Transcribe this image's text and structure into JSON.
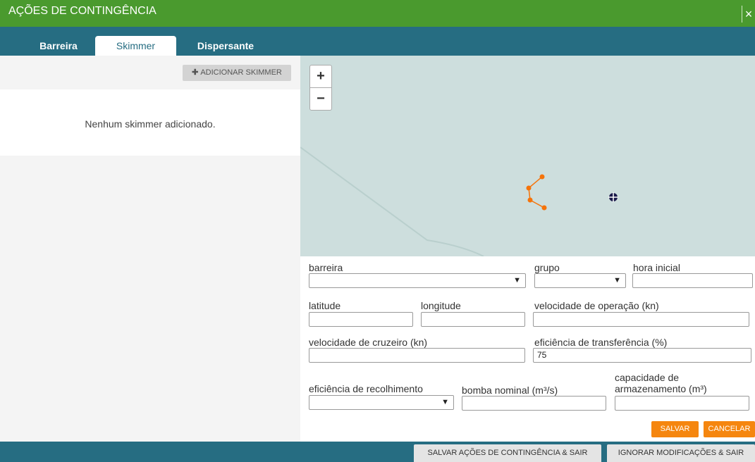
{
  "window": {
    "title": "AÇÕES DE CONTINGÊNCIA",
    "close_glyph": "×"
  },
  "tabs": [
    {
      "label": "Barreira",
      "active": false
    },
    {
      "label": "Skimmer",
      "active": true
    },
    {
      "label": "Dispersante",
      "active": false
    }
  ],
  "left_panel": {
    "add_button_label": "ADICIONAR SKIMMER",
    "empty_message": "Nenhum skimmer adicionado."
  },
  "map": {
    "zoom_in": "+",
    "zoom_out": "−",
    "polyline_color": "#f5730a",
    "marker_icon": "crosshair-marker-icon"
  },
  "form": {
    "barreira_label": "barreira",
    "barreira_value": "",
    "grupo_label": "grupo",
    "grupo_value": "",
    "hora_inicial_label": "hora inicial",
    "hora_inicial_value": "",
    "latitude_label": "latitude",
    "latitude_value": "",
    "longitude_label": "longitude",
    "longitude_value": "",
    "velocidade_operacao_label": "velocidade de operação (kn)",
    "velocidade_operacao_value": "",
    "velocidade_cruzeiro_label": "velocidade de cruzeiro (kn)",
    "velocidade_cruzeiro_value": "",
    "eficiencia_transferencia_label": "eficiência de transferência (%)",
    "eficiencia_transferencia_value": "75",
    "eficiencia_recolhimento_label": "eficiência de recolhimento",
    "eficiencia_recolhimento_value": "",
    "bomba_nominal_label": "bomba nominal (m³/s)",
    "bomba_nominal_value": "",
    "capacidade_label_1": "capacidade de",
    "capacidade_label_2": "armazenamento (m³)",
    "capacidade_value": "",
    "save_label": "SALVAR",
    "cancel_label": "CANCELAR"
  },
  "footer": {
    "save_exit_label": "SALVAR AÇÕES DE CONTINGÊNCIA & SAIR",
    "ignore_label": "IGNORAR MODIFICAÇÕES & SAIR"
  },
  "colors": {
    "header_green": "#4a9a2e",
    "bar_teal": "#266d82",
    "accent_orange": "#f5860f"
  }
}
